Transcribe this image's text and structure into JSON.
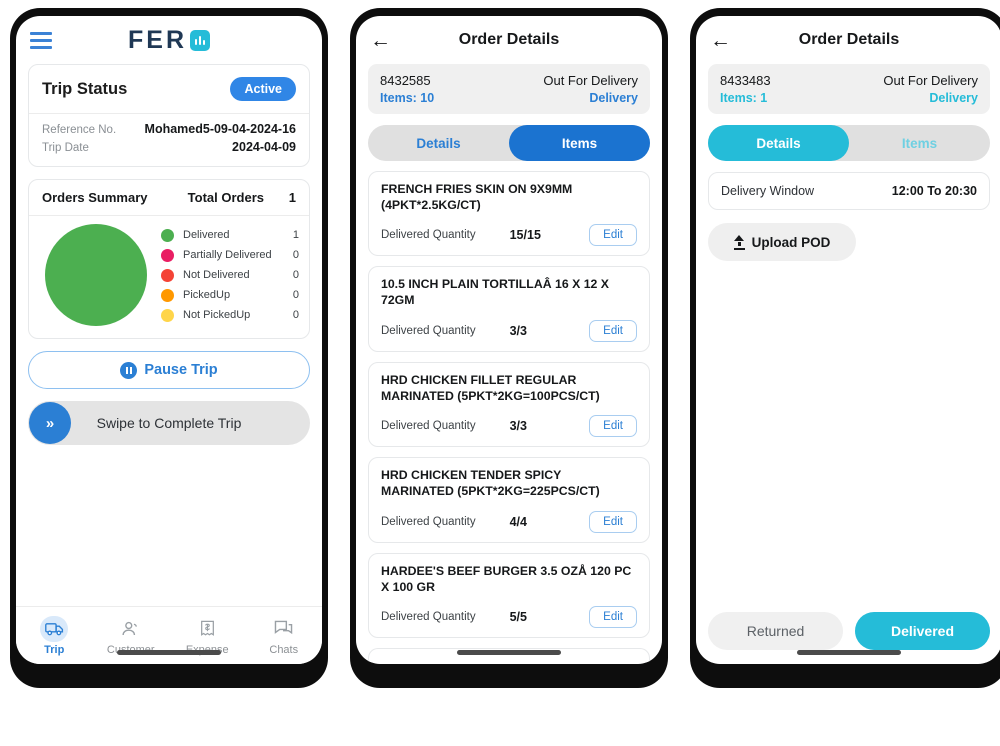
{
  "colors": {
    "blue": "#3086e6",
    "blue_dark": "#2b7fd4",
    "cyan": "#25bcd8",
    "green": "#4caf50",
    "pink": "#e91e63",
    "red": "#f44336",
    "orange": "#ff9800",
    "yellow": "#ffd54a"
  },
  "phone1": {
    "topbar": {
      "menu_icon": "hamburger-icon",
      "brand_text": "FER",
      "brand_mark_icon": "fero-logo-mark"
    },
    "trip_status": {
      "title": "Trip Status",
      "badge": "Active",
      "rows": [
        {
          "key": "Reference No.",
          "value": "Mohamed5-09-04-2024-16"
        },
        {
          "key": "Trip Date",
          "value": "2024-04-09"
        }
      ]
    },
    "orders_summary": {
      "title": "Orders Summary",
      "total_label": "Total Orders",
      "total_value": "1",
      "legend": [
        {
          "label": "Delivered",
          "value": "1",
          "color": "#4caf50"
        },
        {
          "label": "Partially Delivered",
          "value": "0",
          "color": "#e91e63"
        },
        {
          "label": "Not Delivered",
          "value": "0",
          "color": "#f44336"
        },
        {
          "label": "PickedUp",
          "value": "0",
          "color": "#ff9800"
        },
        {
          "label": "Not PickedUp",
          "value": "0",
          "color": "#ffd54a"
        }
      ]
    },
    "chart_data": {
      "type": "pie",
      "title": "Orders Summary",
      "categories": [
        "Delivered",
        "Partially Delivered",
        "Not Delivered",
        "PickedUp",
        "Not PickedUp"
      ],
      "values": [
        1,
        0,
        0,
        0,
        0
      ],
      "colors": [
        "#4caf50",
        "#e91e63",
        "#f44336",
        "#ff9800",
        "#ffd54a"
      ],
      "total": 1,
      "legend": "right"
    },
    "pause_button": "Pause Trip",
    "swipe": {
      "label": "Swipe to Complete Trip",
      "knob_icon": "chevrons-right-icon"
    },
    "tabs": [
      {
        "label": "Trip",
        "icon": "truck-icon",
        "active": true
      },
      {
        "label": "Customer",
        "icon": "person-icon",
        "active": false
      },
      {
        "label": "Expense",
        "icon": "receipt-icon",
        "active": false
      },
      {
        "label": "Chats",
        "icon": "chat-icon",
        "active": false
      }
    ]
  },
  "phone2": {
    "title": "Order Details",
    "back_icon": "back-arrow-icon",
    "order": {
      "id": "8432585",
      "status": "Out For Delivery",
      "items_label": "Items: 10",
      "type": "Delivery"
    },
    "tabs": [
      {
        "label": "Details",
        "active": false
      },
      {
        "label": "Items",
        "active": true
      }
    ],
    "qty_label": "Delivered Quantity",
    "edit_label": "Edit",
    "items": [
      {
        "name": "FRENCH FRIES SKIN ON 9X9MM (4PKT*2.5KG/CT)",
        "qty": "15/15"
      },
      {
        "name": "10.5 INCH PLAIN TORTILLAÂ 16 X 12 X 72GM",
        "qty": "3/3"
      },
      {
        "name": "HRD CHICKEN FILLET REGULAR MARINATED (5PKT*2KG=100PCS/CT)",
        "qty": "3/3"
      },
      {
        "name": "HRD CHICKEN TENDER SPICY MARINATED (5PKT*2KG=225PCS/CT)",
        "qty": "4/4"
      },
      {
        "name": "HARDEE'S BEEF BURGER 3.5 OZÅ  120 PC X 100 GR",
        "qty": "5/5"
      }
    ]
  },
  "phone3": {
    "title": "Order Details",
    "back_icon": "back-arrow-icon",
    "order": {
      "id": "8433483",
      "status": "Out For Delivery",
      "items_label": "Items: 1",
      "type": "Delivery"
    },
    "tabs": [
      {
        "label": "Details",
        "active": true
      },
      {
        "label": "Items",
        "active": false
      }
    ],
    "delivery_window": {
      "label": "Delivery Window",
      "value": "12:00 To 20:30"
    },
    "upload_pod": {
      "label": "Upload POD",
      "icon": "upload-icon"
    },
    "footer": [
      {
        "label": "Returned",
        "primary": false
      },
      {
        "label": "Delivered",
        "primary": true
      }
    ]
  }
}
